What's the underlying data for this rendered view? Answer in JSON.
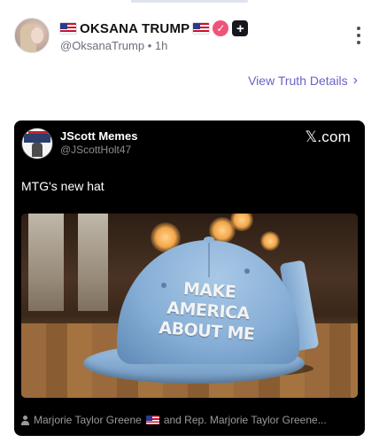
{
  "post": {
    "display_name": "OKSANA TRUMP",
    "handle": "@OksanaTrump",
    "separator": "•",
    "time_ago": "1h",
    "view_details_label": "View Truth Details",
    "chevron_glyph": "›",
    "more_menu_icon": "kebab-vertical-icon",
    "verified_icon": "verified-check-icon",
    "plus_icon": "plus-badge-icon",
    "colors": {
      "link": "#6a62c8",
      "verified": "#f0537a",
      "handle_text": "#6b6f7b"
    }
  },
  "embed": {
    "author_name": "JScott Memes",
    "author_handle": "@JScottHolt47",
    "source_label": "𝕏.com",
    "text": "MTG's new hat",
    "image": {
      "cap_text_line1": "MAKE AMERICA",
      "cap_text_line2": "ABOUT ME"
    },
    "footer_people_icon": "person-icon",
    "footer_text_before_flag": "Marjorie Taylor Greene",
    "footer_text_after_flag": "and Rep. Marjorie Taylor Greene..."
  }
}
